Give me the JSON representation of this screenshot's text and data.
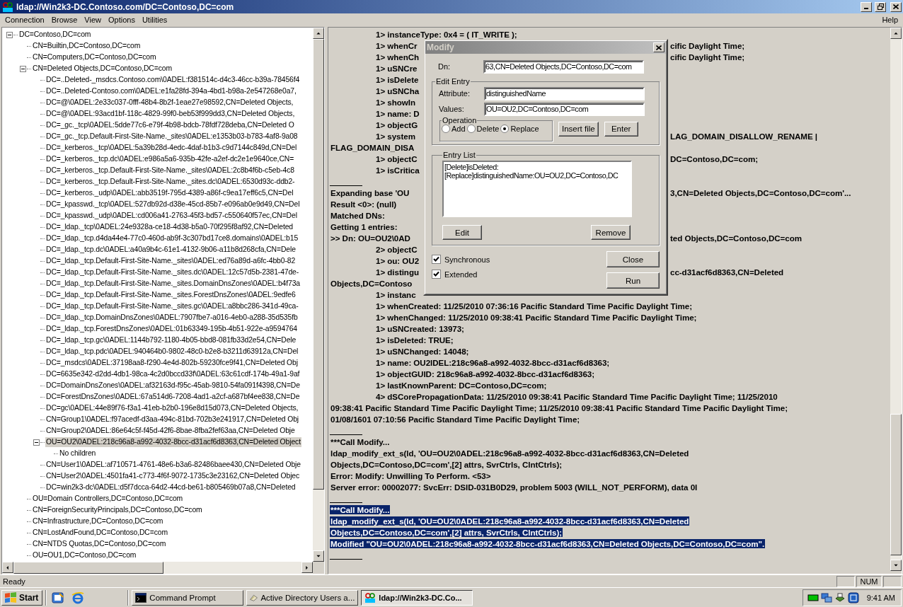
{
  "window": {
    "title": "ldap://Win2k3-DC.Contoso.com/DC=Contoso,DC=com"
  },
  "menu": [
    "Connection",
    "Browse",
    "View",
    "Options",
    "Utilities"
  ],
  "help_menu": "Help",
  "tree": [
    {
      "label": "DC=Contoso,DC=com",
      "selected": false,
      "expanded": true,
      "children": [
        {
          "label": "CN=Builtin,DC=Contoso,DC=com",
          "selected": false
        },
        {
          "label": "CN=Computers,DC=Contoso,DC=com",
          "selected": false
        },
        {
          "label": "CN=Deleted Objects,DC=Contoso,DC=com",
          "selected": false,
          "expanded": true,
          "children": [
            {
              "label": "DC=..Deleted-_msdcs.Contoso.com\\0ADEL:f381514c-d4c3-46cc-b39a-78456f4",
              "selected": false
            },
            {
              "label": "DC=..Deleted-Contoso.com\\0ADEL:e1fa28fd-394a-4bd1-b98a-2e547268e0a7,",
              "selected": false
            },
            {
              "label": "DC=@\\0ADEL:2e33c037-0fff-48b4-8b2f-1eae27e98592,CN=Deleted Objects,",
              "selected": false
            },
            {
              "label": "DC=@\\0ADEL:93acd1bf-118c-4829-99f0-beb53f999dd3,CN=Deleted Objects,",
              "selected": false
            },
            {
              "label": "DC=_gc._tcp\\0ADEL:5dde77c6-e79f-4b98-bdcb-78fdf728deba,CN=Deleted O",
              "selected": false
            },
            {
              "label": "DC=_gc._tcp.Default-First-Site-Name._sites\\0ADEL:e1353b03-b783-4af8-9a08",
              "selected": false
            },
            {
              "label": "DC=_kerberos._tcp\\0ADEL:5a39b28d-4edc-4daf-b1b3-c9d7144c849d,CN=Del",
              "selected": false
            },
            {
              "label": "DC=_kerberos._tcp.dc\\0ADEL:e986a5a6-935b-42fe-a2ef-dc2e1e9640ce,CN=",
              "selected": false
            },
            {
              "label": "DC=_kerberos._tcp.Default-First-Site-Name._sites\\0ADEL:2c8b4f6b-c5eb-4c8",
              "selected": false
            },
            {
              "label": "DC=_kerberos._tcp.Default-First-Site-Name._sites.dc\\0ADEL:6530d93c-ddb2-",
              "selected": false
            },
            {
              "label": "DC=_kerberos._udp\\0ADEL:abb3519f-795d-4389-a86f-c9ea17eff6c5,CN=Del",
              "selected": false
            },
            {
              "label": "DC=_kpasswd._tcp\\0ADEL:527db92d-d38e-45cd-85b7-e096ab0e9d49,CN=Del",
              "selected": false
            },
            {
              "label": "DC=_kpasswd._udp\\0ADEL:cd006a41-2763-45f3-bd57-c550640f57ec,CN=Del",
              "selected": false
            },
            {
              "label": "DC=_ldap._tcp\\0ADEL:24e9328a-ce18-4d38-b5a0-70f295f8af92,CN=Deleted",
              "selected": false
            },
            {
              "label": "DC=_ldap._tcp.d4da44e4-77c0-460d-ab9f-3c307bd17ce8.domains\\0ADEL:b15",
              "selected": false
            },
            {
              "label": "DC=_ldap._tcp.dc\\0ADEL:a40a9b4c-61e1-4132-9b06-a11b8d268cfa,CN=Dele",
              "selected": false
            },
            {
              "label": "DC=_ldap._tcp.Default-First-Site-Name._sites\\0ADEL:ed76a89d-a6fc-4bb0-82",
              "selected": false
            },
            {
              "label": "DC=_ldap._tcp.Default-First-Site-Name._sites.dc\\0ADEL:12c57d5b-2381-47de-",
              "selected": false
            },
            {
              "label": "DC=_ldap._tcp.Default-First-Site-Name._sites.DomainDnsZones\\0ADEL:b4f73a",
              "selected": false
            },
            {
              "label": "DC=_ldap._tcp.Default-First-Site-Name._sites.ForestDnsZones\\0ADEL:9edfe6",
              "selected": false
            },
            {
              "label": "DC=_ldap._tcp.Default-First-Site-Name._sites.gc\\0ADEL:a8bbc286-341d-49ca-",
              "selected": false
            },
            {
              "label": "DC=_ldap._tcp.DomainDnsZones\\0ADEL:7907fbe7-a016-4eb0-a288-35d535fb",
              "selected": false
            },
            {
              "label": "DC=_ldap._tcp.ForestDnsZones\\0ADEL:01b63349-195b-4b51-922e-a9594764",
              "selected": false
            },
            {
              "label": "DC=_ldap._tcp.gc\\0ADEL:1144b792-1180-4b05-bbd8-081fb33d2e54,CN=Dele",
              "selected": false
            },
            {
              "label": "DC=_ldap._tcp.pdc\\0ADEL:940464b0-9802-48c0-b2e8-b3211d63912a,CN=Del",
              "selected": false
            },
            {
              "label": "DC=_msdcs\\0ADEL:37198aa8-f290-4e4d-802b-59230fce9f41,CN=Deleted Obj",
              "selected": false
            },
            {
              "label": "DC=6635e342-d2dd-4db1-98ca-4c2d0bccd33f\\0ADEL:63c61cdf-174b-49a1-9af",
              "selected": false
            },
            {
              "label": "DC=DomainDnsZones\\0ADEL:af32163d-f95c-45ab-9810-54fa091f4398,CN=De",
              "selected": false
            },
            {
              "label": "DC=ForestDnsZones\\0ADEL:67a514d6-7208-4ad1-a2cf-a687bf4ee838,CN=De",
              "selected": false
            },
            {
              "label": "DC=gc\\0ADEL:44e89f76-f3a1-41eb-b2b0-196e8d15d073,CN=Deleted Objects,",
              "selected": false
            },
            {
              "label": "CN=Group1\\0ADEL:f97acedf-d3aa-494c-81bd-702b3e241917,CN=Deleted Obj",
              "selected": false
            },
            {
              "label": "CN=Group2\\0ADEL:86e64c5f-f45d-42f6-8bae-8fba2fef63aa,CN=Deleted Obje",
              "selected": false
            },
            {
              "label": "OU=OU2\\0ADEL:218c96a8-a992-4032-8bcc-d31acf6d8363,CN=Deleted Object",
              "selected": true,
              "expanded": true,
              "children": [
                {
                  "label": "No children",
                  "selected": false
                }
              ]
            },
            {
              "label": "CN=User1\\0ADEL:af710571-4761-48e6-b3a6-82486baee430,CN=Deleted Obje",
              "selected": false
            },
            {
              "label": "CN=User2\\0ADEL:4501fa41-c773-4f6f-9072-1735c3e23162,CN=Deleted Objec",
              "selected": false
            },
            {
              "label": "DC=win2k3-dc\\0ADEL:d5f7dcca-64d2-44cd-be61-b805469b07a8,CN=Deleted",
              "selected": false
            }
          ]
        },
        {
          "label": "OU=Domain Controllers,DC=Contoso,DC=com",
          "selected": false
        },
        {
          "label": "CN=ForeignSecurityPrincipals,DC=Contoso,DC=com",
          "selected": false
        },
        {
          "label": "CN=Infrastructure,DC=Contoso,DC=com",
          "selected": false
        },
        {
          "label": "CN=LostAndFound,DC=Contoso,DC=com",
          "selected": false
        },
        {
          "label": "CN=NTDS Quotas,DC=Contoso,DC=com",
          "selected": false
        },
        {
          "label": "OU=OU1,DC=Contoso,DC=com",
          "selected": false
        }
      ]
    }
  ],
  "log": [
    {
      "kind": "attr",
      "text": "1> instanceType: 0x4 = ( IT_WRITE );",
      "selected": false
    },
    {
      "kind": "attr",
      "text": "1> whenCr",
      "right": "cific Daylight Time;",
      "selected": false
    },
    {
      "kind": "attr",
      "text": "1> whenCh",
      "right": "cific Daylight Time;",
      "selected": false
    },
    {
      "kind": "attr",
      "text": "1> uSNCre",
      "selected": false
    },
    {
      "kind": "attr",
      "text": "1> isDelete",
      "selected": false
    },
    {
      "kind": "attr",
      "text": "1> uSNCha",
      "selected": false
    },
    {
      "kind": "attr",
      "text": "1> showIn",
      "selected": false
    },
    {
      "kind": "attr",
      "text": "1> name: D",
      "selected": false
    },
    {
      "kind": "attr",
      "text": "1> objectG",
      "selected": false
    },
    {
      "kind": "attr",
      "text": "1> system",
      "right": "LAG_DOMAIN_DISALLOW_RENAME |",
      "selected": false
    },
    {
      "kind": "plain",
      "text": "FLAG_DOMAIN_DISA",
      "selected": false
    },
    {
      "kind": "attr",
      "text": "1> objectC",
      "right": "DC=Contoso,DC=com;",
      "selected": false
    },
    {
      "kind": "attr",
      "text": "1> isCritica",
      "selected": false
    },
    {
      "kind": "rule"
    },
    {
      "kind": "plain",
      "text": "Expanding base 'OU",
      "right": "3,CN=Deleted Objects,DC=Contoso,DC=com'...",
      "selected": false
    },
    {
      "kind": "plain",
      "text": "Result <0>: (null)",
      "selected": false
    },
    {
      "kind": "plain",
      "text": "Matched DNs:",
      "selected": false
    },
    {
      "kind": "plain",
      "text": "Getting 1 entries:",
      "selected": false
    },
    {
      "kind": "plain",
      "text": ">> Dn: OU=OU2\\0AD",
      "right": "ted Objects,DC=Contoso,DC=com",
      "selected": false
    },
    {
      "kind": "attr",
      "text": "2> objectC",
      "selected": false
    },
    {
      "kind": "attr",
      "text": "1> ou: OU2",
      "selected": false
    },
    {
      "kind": "attr",
      "text": "1> distingu",
      "right": "cc-d31acf6d8363,CN=Deleted",
      "selected": false
    },
    {
      "kind": "plain",
      "text": "Objects,DC=Contoso",
      "selected": false
    },
    {
      "kind": "attr",
      "text": "1> instanc",
      "selected": false
    },
    {
      "kind": "attr",
      "text": "1> whenCreated: 11/25/2010 07:36:16 Pacific Standard Time Pacific Daylight Time;",
      "selected": false
    },
    {
      "kind": "attr",
      "text": "1> whenChanged: 11/25/2010 09:38:41 Pacific Standard Time Pacific Daylight Time;",
      "selected": false
    },
    {
      "kind": "attr",
      "text": "1> uSNCreated: 13973;",
      "selected": false
    },
    {
      "kind": "attr",
      "text": "1> isDeleted: TRUE;",
      "selected": false
    },
    {
      "kind": "attr",
      "text": "1> uSNChanged: 14048;",
      "selected": false
    },
    {
      "kind": "attr",
      "text": "1> name: OU2IDEL:218c96a8-a992-4032-8bcc-d31acf6d8363;",
      "selected": false
    },
    {
      "kind": "attr",
      "text": "1> objectGUID: 218c96a8-a992-4032-8bcc-d31acf6d8363;",
      "selected": false
    },
    {
      "kind": "attr",
      "text": "1> lastKnownParent: DC=Contoso,DC=com;",
      "selected": false
    },
    {
      "kind": "attr",
      "text": "4> dSCorePropagationData: 11/25/2010 09:38:41 Pacific Standard Time Pacific Daylight Time; 11/25/2010",
      "selected": false
    },
    {
      "kind": "plain",
      "text": "09:38:41 Pacific Standard Time Pacific Daylight Time; 11/25/2010 09:38:41 Pacific Standard Time Pacific Daylight Time;",
      "selected": false
    },
    {
      "kind": "plain",
      "text": "01/08/1601 07:10:56 Pacific Standard Time Pacific Daylight Time;",
      "selected": false
    },
    {
      "kind": "rule"
    },
    {
      "kind": "plain",
      "text": "***Call Modify...",
      "selected": false
    },
    {
      "kind": "plain",
      "text": "ldap_modify_ext_s(ld, 'OU=OU2\\0ADEL:218c96a8-a992-4032-8bcc-d31acf6d8363,CN=Deleted",
      "selected": false
    },
    {
      "kind": "plain",
      "text": "Objects,DC=Contoso,DC=com',[2] attrs, SvrCtrls, ClntCtrls);",
      "selected": false
    },
    {
      "kind": "plain",
      "text": "Error: Modify: Unwilling To Perform. <53>",
      "selected": false
    },
    {
      "kind": "plain",
      "text": "Server error: 00002077: SvcErr: DSID-031B0D29, problem 5003 (WILL_NOT_PERFORM), data 0I",
      "selected": false
    },
    {
      "kind": "rule"
    },
    {
      "kind": "plain",
      "text": "***Call Modify...",
      "selected": true
    },
    {
      "kind": "plain",
      "text": "ldap_modify_ext_s(ld, 'OU=OU2\\0ADEL:218c96a8-a992-4032-8bcc-d31acf6d8363,CN=Deleted",
      "selected": true
    },
    {
      "kind": "plain",
      "text": "Objects,DC=Contoso,DC=com',[2] attrs, SvrCtrls, ClntCtrls);",
      "selected": true
    },
    {
      "kind": "plain",
      "text": "Modified \"OU=OU2\\0ADEL:218c96a8-a992-4032-8bcc-d31acf6d8363,CN=Deleted Objects,DC=Contoso,DC=com\".",
      "selected": true
    },
    {
      "kind": "rule"
    }
  ],
  "dialog": {
    "title": "Modify",
    "dn": {
      "label": "Dn:",
      "value": "63,CN=Deleted Objects,DC=Contoso,DC=com"
    },
    "edit_entry": {
      "label": "Edit Entry",
      "attribute": {
        "label": "Attribute:",
        "value": "distinguishedName"
      },
      "values": {
        "label": "Values:",
        "value": "OU=OU2,DC=Contoso,DC=com"
      },
      "operation": {
        "label": "Operation",
        "options": [
          {
            "label": "Add",
            "selected": false
          },
          {
            "label": "Delete",
            "selected": false
          },
          {
            "label": "Replace",
            "selected": true
          }
        ]
      },
      "buttons": [
        "Insert file",
        "Enter"
      ]
    },
    "entry_list": {
      "label": "Entry List",
      "items": [
        "[Delete]isDeleted:",
        "[Replace]distinguishedName:OU=OU2,DC=Contoso,DC"
      ],
      "buttons": [
        "Edit",
        "Remove"
      ]
    },
    "checkboxes": [
      {
        "label": "Synchronous",
        "checked": true
      },
      {
        "label": "Extended",
        "checked": true
      }
    ],
    "buttons": [
      "Close",
      "Run"
    ]
  },
  "status_bar": {
    "text": "Ready",
    "indicator": "NUM"
  },
  "taskbar": {
    "start": "Start",
    "tasks": [
      {
        "kind": "console",
        "label": "Command Prompt",
        "selected": false
      },
      {
        "kind": "directory",
        "label": "Active Directory Users a...",
        "selected": false
      },
      {
        "kind": "ldap",
        "label": "ldap://Win2k3-DC.Co...",
        "selected": true
      }
    ],
    "clock": "9:41 AM"
  }
}
